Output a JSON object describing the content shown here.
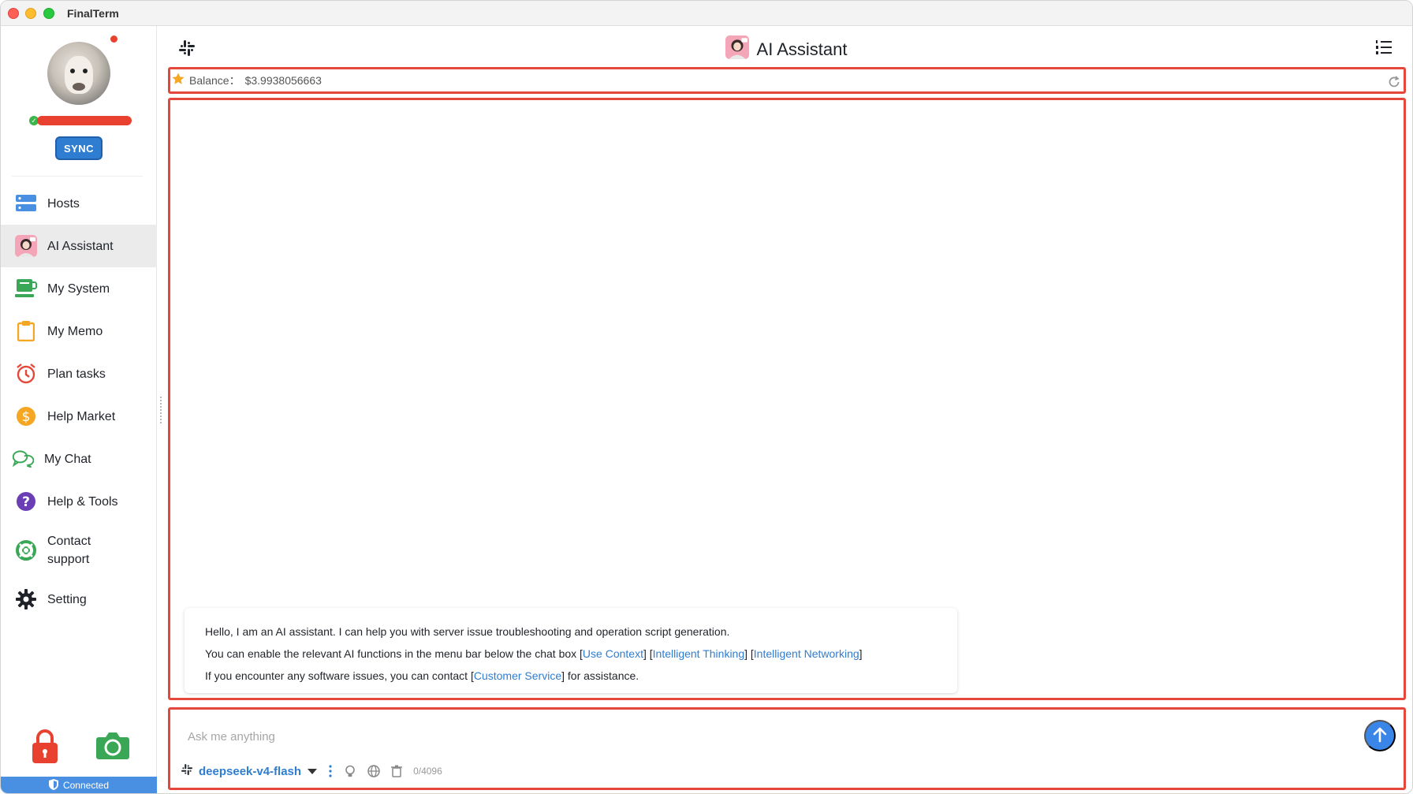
{
  "window": {
    "title": "FinalTerm"
  },
  "sidebar": {
    "sync_label": "SYNC",
    "items": [
      {
        "label": "Hosts",
        "icon": "hosts-icon"
      },
      {
        "label": "AI Assistant",
        "icon": "ai-assistant-icon",
        "active": true
      },
      {
        "label": "My System",
        "icon": "my-system-icon"
      },
      {
        "label": "My Memo",
        "icon": "memo-icon"
      },
      {
        "label": "Plan tasks",
        "icon": "alarm-clock-icon"
      },
      {
        "label": "Help Market",
        "icon": "dollar-icon"
      },
      {
        "label": "My Chat",
        "icon": "chat-icon"
      },
      {
        "label": "Help & Tools",
        "icon": "help-icon"
      },
      {
        "label": "Contact support",
        "icon": "support-icon"
      },
      {
        "label": "Setting",
        "icon": "gear-icon"
      }
    ],
    "status": "Connected"
  },
  "header": {
    "title": "AI Assistant"
  },
  "balance": {
    "label": "Balance：",
    "value": "$3.9938056663"
  },
  "message": {
    "line1": "Hello, I am an AI assistant. I can help you with server issue troubleshooting and operation script generation.",
    "line2_prefix": "You can enable the relevant AI functions in the menu bar below the chat box [",
    "link_context": "Use Context",
    "sep1": "] [",
    "link_thinking": "Intelligent Thinking",
    "sep2": "] [",
    "link_networking": "Intelligent Networking",
    "line2_suffix": "]",
    "line3_prefix": "If you encounter any software issues, you can contact [",
    "link_service": "Customer Service",
    "line3_suffix": "] for assistance."
  },
  "input": {
    "placeholder": "Ask me anything",
    "model": "deepseek-v4-flash",
    "counter": "0/4096"
  },
  "colors": {
    "accent": "#2f7dd1",
    "highlight_border": "#e3483a",
    "status_bar": "#4a90e2"
  }
}
